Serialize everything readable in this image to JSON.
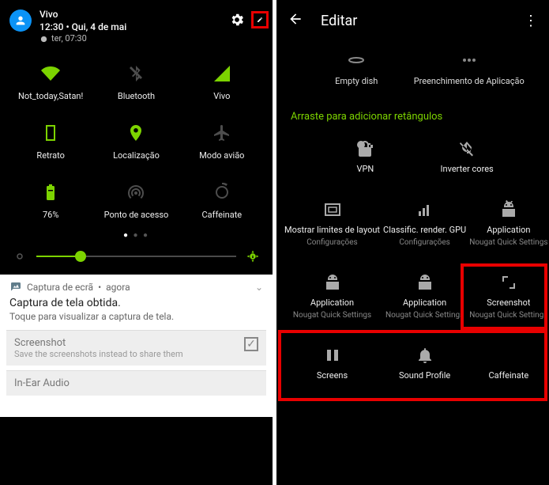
{
  "left": {
    "carrier": "Vivo",
    "time": "12:30",
    "date": "Qui, 4 de mai",
    "alarm": "ter, 07:30",
    "tiles": [
      {
        "label": "Not_today,Satan!",
        "icon": "wifi",
        "state": "active"
      },
      {
        "label": "Bluetooth",
        "icon": "bluetooth",
        "state": "inactive"
      },
      {
        "label": "Vivo",
        "icon": "signal",
        "state": "active"
      },
      {
        "label": "Retrato",
        "icon": "portrait",
        "state": "active"
      },
      {
        "label": "Localização",
        "icon": "location",
        "state": "active"
      },
      {
        "label": "Modo avião",
        "icon": "airplane",
        "state": "inactive"
      },
      {
        "label": "76%",
        "icon": "battery",
        "state": "active"
      },
      {
        "label": "Ponto de acesso",
        "icon": "hotspot",
        "state": "inactive"
      },
      {
        "label": "Caffeinate",
        "icon": "caffeinate",
        "state": "inactive"
      }
    ],
    "brightness_pct": 22,
    "notification": {
      "app": "Captura de ecrã",
      "when": "agora",
      "title": "Captura de tela obtida.",
      "body": "Toque para visualizar a captura de tela.",
      "sub1_title": "Screenshot",
      "sub1_body": "Save the screenshots instead to share them",
      "sub2_title": "In-Ear Audio"
    }
  },
  "right": {
    "title": "Editar",
    "top_tiles": [
      {
        "label": "Empty dish",
        "icon": "dish"
      },
      {
        "label": "Preenchimento de Aplicação",
        "icon": "dots"
      }
    ],
    "drag_hint": "Arraste para adicionar retângulos",
    "tiles": [
      {
        "title": "VPN",
        "sub": "",
        "icon": "key"
      },
      {
        "title": "Inverter cores",
        "sub": "",
        "icon": "invert"
      },
      {
        "title": "",
        "sub": "",
        "icon": ""
      },
      {
        "title": "Mostrar limites de layout",
        "sub": "Configurações",
        "icon": "bounds"
      },
      {
        "title": "Classific. render. GPU",
        "sub": "Configurações",
        "icon": "gpu"
      },
      {
        "title": "Application",
        "sub": "Nougat Quick Settings",
        "icon": "android"
      },
      {
        "title": "Application",
        "sub": "Nougat Quick Settings",
        "icon": "android"
      },
      {
        "title": "Application",
        "sub": "Nougat Quick Settings",
        "icon": "android"
      },
      {
        "title": "Screenshot",
        "sub": "Nougat Quick Settings",
        "icon": "screenshot"
      },
      {
        "title": "Screens",
        "sub": "",
        "icon": "screens"
      },
      {
        "title": "Sound Profile",
        "sub": "",
        "icon": "bell"
      },
      {
        "title": "Caffeinate",
        "sub": "",
        "icon": ""
      }
    ]
  }
}
